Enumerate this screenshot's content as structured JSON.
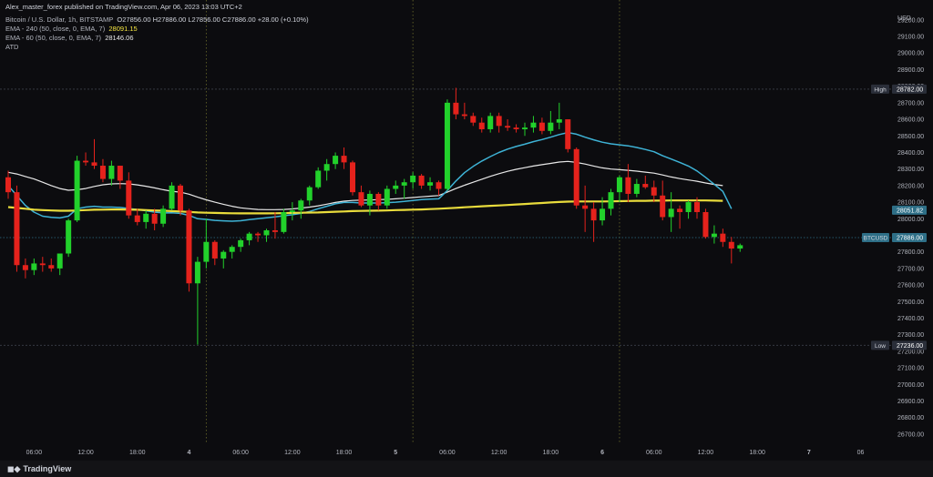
{
  "header": {
    "publisher": "Alex_master_forex published on TradingView.com, Apr 06, 2023 13:03 UTC+2",
    "symbol": "Bitcoin / U.S. Dollar, 1h, BITSTAMP",
    "ohlc": "O27856.00  H27886.00  L27856.00  C27886.00  +28.00 (+0.10%)",
    "ema240_label": "EMA - 240 (50, close, 0, EMA, 7)",
    "ema240_value": "28091.15",
    "ema60_label": "EMA - 60 (50, close, 0, EMA, 7)",
    "ema60_value": "28146.06",
    "atd_label": "ATD"
  },
  "footer": {
    "brand": "TradingView",
    "logo_icon": "tradingview-logo-icon"
  },
  "colors": {
    "background": "#0c0c0f",
    "up": "#22d12b",
    "down": "#e5221c",
    "ema240": "#e9dc3c",
    "ema60": "#e8e8e8",
    "ema_fast": "#3eb3d6",
    "axis_text": "#b2b5be",
    "grid": "#2a2e39"
  },
  "chart_data": {
    "type": "candlestick",
    "currency": "USD",
    "ylim": [
      26650,
      29320
    ],
    "y_ticks": [
      26700,
      26800,
      26900,
      27000,
      27100,
      27200,
      27300,
      27400,
      27500,
      27600,
      27700,
      27800,
      27900,
      28000,
      28100,
      28200,
      28300,
      28400,
      28500,
      28600,
      28700,
      28800,
      28900,
      29000,
      29100,
      29200
    ],
    "x_ticks": [
      {
        "i": 3,
        "label": "06:00"
      },
      {
        "i": 9,
        "label": "12:00"
      },
      {
        "i": 15,
        "label": "18:00"
      },
      {
        "i": 21,
        "label": "4",
        "day": true
      },
      {
        "i": 27,
        "label": "06:00"
      },
      {
        "i": 33,
        "label": "12:00"
      },
      {
        "i": 39,
        "label": "18:00"
      },
      {
        "i": 45,
        "label": "5",
        "day": true
      },
      {
        "i": 51,
        "label": "06:00"
      },
      {
        "i": 57,
        "label": "12:00"
      },
      {
        "i": 63,
        "label": "18:00"
      },
      {
        "i": 69,
        "label": "6",
        "day": true
      },
      {
        "i": 75,
        "label": "06:00"
      },
      {
        "i": 81,
        "label": "12:00"
      },
      {
        "i": 87,
        "label": "18:00"
      },
      {
        "i": 93,
        "label": "7",
        "day": true
      },
      {
        "i": 99,
        "label": "06"
      }
    ],
    "day_separators": [
      23,
      47,
      71
    ],
    "price_labels": [
      {
        "name": "High",
        "value": 28782.0,
        "text": "28782.00",
        "color": "#2a2e39"
      },
      {
        "name": "EMA",
        "value": 28051.82,
        "text": "28051.82",
        "color": "#2e6f87"
      },
      {
        "name": "BTCUSD",
        "value": 27886.0,
        "text": "27886.00",
        "color": "#2e6f87"
      },
      {
        "name": "Low",
        "value": 27236.0,
        "text": "27236.00",
        "color": "#2a2e39"
      }
    ],
    "candles": [
      [
        28250,
        28290,
        28120,
        28160
      ],
      [
        28160,
        28200,
        27680,
        27720
      ],
      [
        27720,
        27760,
        27640,
        27690
      ],
      [
        27690,
        27760,
        27660,
        27730
      ],
      [
        27730,
        27770,
        27680,
        27720
      ],
      [
        27720,
        27760,
        27680,
        27700
      ],
      [
        27700,
        27790,
        27660,
        27790
      ],
      [
        27790,
        28000,
        27770,
        27990
      ],
      [
        27990,
        28380,
        27980,
        28350
      ],
      [
        28350,
        28400,
        28320,
        28340
      ],
      [
        28340,
        28480,
        28300,
        28320
      ],
      [
        28320,
        28360,
        28220,
        28240
      ],
      [
        28240,
        28350,
        28200,
        28320
      ],
      [
        28320,
        28320,
        28180,
        28230
      ],
      [
        28230,
        28280,
        28000,
        28020
      ],
      [
        28020,
        28060,
        27960,
        27980
      ],
      [
        27980,
        28050,
        27940,
        28030
      ],
      [
        28030,
        28060,
        27930,
        27970
      ],
      [
        27970,
        28080,
        27950,
        28060
      ],
      [
        28060,
        28220,
        28050,
        28200
      ],
      [
        28200,
        28210,
        28020,
        28050
      ],
      [
        28050,
        28060,
        27560,
        27610
      ],
      [
        27610,
        27770,
        27240,
        27740
      ],
      [
        27740,
        28000,
        27700,
        27860
      ],
      [
        27860,
        27870,
        27720,
        27760
      ],
      [
        27760,
        27810,
        27700,
        27800
      ],
      [
        27800,
        27840,
        27760,
        27830
      ],
      [
        27830,
        27880,
        27800,
        27870
      ],
      [
        27870,
        27920,
        27840,
        27910
      ],
      [
        27910,
        27920,
        27860,
        27900
      ],
      [
        27900,
        27940,
        27860,
        27930
      ],
      [
        27930,
        28040,
        27880,
        27920
      ],
      [
        27920,
        28060,
        27910,
        28040
      ],
      [
        28040,
        28100,
        27990,
        28050
      ],
      [
        28050,
        28120,
        28000,
        28110
      ],
      [
        28110,
        28200,
        28080,
        28190
      ],
      [
        28190,
        28310,
        28180,
        28290
      ],
      [
        28290,
        28360,
        28230,
        28330
      ],
      [
        28330,
        28400,
        28300,
        28380
      ],
      [
        28380,
        28430,
        28300,
        28340
      ],
      [
        28340,
        28350,
        28140,
        28160
      ],
      [
        28160,
        28200,
        28070,
        28080
      ],
      [
        28080,
        28170,
        28020,
        28150
      ],
      [
        28150,
        28160,
        28050,
        28080
      ],
      [
        28080,
        28200,
        28060,
        28180
      ],
      [
        28180,
        28230,
        28150,
        28200
      ],
      [
        28200,
        28240,
        28120,
        28220
      ],
      [
        28220,
        28280,
        28180,
        28260
      ],
      [
        28260,
        28270,
        28180,
        28200
      ],
      [
        28200,
        28250,
        28170,
        28220
      ],
      [
        28220,
        28230,
        28140,
        28180
      ],
      [
        28180,
        28720,
        28170,
        28700
      ],
      [
        28700,
        28790,
        28600,
        28630
      ],
      [
        28630,
        28700,
        28600,
        28620
      ],
      [
        28620,
        28640,
        28560,
        28580
      ],
      [
        28580,
        28610,
        28520,
        28540
      ],
      [
        28540,
        28640,
        28520,
        28620
      ],
      [
        28620,
        28640,
        28520,
        28560
      ],
      [
        28560,
        28600,
        28530,
        28550
      ],
      [
        28550,
        28570,
        28520,
        28540
      ],
      [
        28540,
        28580,
        28500,
        28550
      ],
      [
        28550,
        28620,
        28520,
        28580
      ],
      [
        28580,
        28610,
        28510,
        28530
      ],
      [
        28530,
        28650,
        28510,
        28580
      ],
      [
        28580,
        28700,
        28540,
        28600
      ],
      [
        28600,
        28600,
        28400,
        28420
      ],
      [
        28420,
        28430,
        28060,
        28080
      ],
      [
        28080,
        28200,
        27920,
        28060
      ],
      [
        28060,
        28100,
        27860,
        27990
      ],
      [
        27990,
        28130,
        27960,
        28060
      ],
      [
        28060,
        28180,
        28020,
        28160
      ],
      [
        28160,
        28260,
        28100,
        28250
      ],
      [
        28250,
        28330,
        28100,
        28150
      ],
      [
        28150,
        28240,
        28130,
        28210
      ],
      [
        28210,
        28260,
        28180,
        28190
      ],
      [
        28190,
        28230,
        28100,
        28140
      ],
      [
        28140,
        28230,
        27990,
        28010
      ],
      [
        28010,
        28160,
        27920,
        28060
      ],
      [
        28060,
        28080,
        27940,
        28040
      ],
      [
        28040,
        28110,
        28000,
        28100
      ],
      [
        28100,
        28130,
        28000,
        28040
      ],
      [
        28040,
        28060,
        27880,
        27890
      ],
      [
        27890,
        27960,
        27850,
        27910
      ],
      [
        27910,
        27940,
        27830,
        27860
      ],
      [
        27860,
        27890,
        27730,
        27820
      ],
      [
        27820,
        27850,
        27800,
        27840
      ]
    ],
    "ema240": [
      28070,
      28065,
      28060,
      28055,
      28052,
      28050,
      28048,
      28048,
      28050,
      28052,
      28054,
      28055,
      28056,
      28056,
      28055,
      28054,
      28052,
      28050,
      28048,
      28046,
      28044,
      28041,
      28038,
      28036,
      28035,
      28034,
      28033,
      28032,
      28032,
      28032,
      28032,
      28033,
      28034,
      28035,
      28036,
      28037,
      28038,
      28040,
      28042,
      28044,
      28046,
      28047,
      28048,
      28049,
      28050,
      28052,
      28053,
      28055,
      28056,
      28058,
      28060,
      28063,
      28066,
      28069,
      28072,
      28075,
      28078,
      28080,
      28083,
      28086,
      28089,
      28092,
      28095,
      28098,
      28101,
      28103,
      28104,
      28104,
      28104,
      28104,
      28105,
      28106,
      28107,
      28108,
      28108,
      28109,
      28109,
      28110,
      28110,
      28110,
      28110,
      28110,
      28109,
      28108
    ],
    "ema60": [
      28280,
      28270,
      28255,
      28240,
      28220,
      28200,
      28182,
      28172,
      28175,
      28182,
      28195,
      28205,
      28210,
      28212,
      28210,
      28204,
      28196,
      28186,
      28175,
      28166,
      28160,
      28148,
      28130,
      28114,
      28100,
      28087,
      28075,
      28066,
      28060,
      28056,
      28055,
      28055,
      28056,
      28059,
      28064,
      28070,
      28078,
      28088,
      28098,
      28106,
      28110,
      28112,
      28113,
      28115,
      28117,
      28120,
      28124,
      28128,
      28132,
      28136,
      28140,
      28160,
      28182,
      28202,
      28220,
      28238,
      28256,
      28272,
      28286,
      28298,
      28308,
      28318,
      28326,
      28334,
      28342,
      28346,
      28340,
      28330,
      28318,
      28307,
      28300,
      28296,
      28292,
      28287,
      28281,
      28275,
      28264,
      28252,
      28242,
      28234,
      28226,
      28216,
      28207,
      28200
    ],
    "ema_fast": [
      28200,
      28140,
      28080,
      28040,
      28015,
      28008,
      28005,
      28015,
      28060,
      28070,
      28075,
      28070,
      28070,
      28068,
      28062,
      28055,
      28048,
      28040,
      28035,
      28036,
      28032,
      28020,
      28000,
      27996,
      27990,
      27987,
      27985,
      27988,
      27995,
      28000,
      28006,
      28011,
      28018,
      28024,
      28032,
      28044,
      28060,
      28075,
      28090,
      28098,
      28098,
      28095,
      28095,
      28095,
      28097,
      28100,
      28104,
      28110,
      28115,
      28118,
      28120,
      28170,
      28228,
      28278,
      28316,
      28348,
      28375,
      28400,
      28420,
      28436,
      28450,
      28465,
      28478,
      28492,
      28508,
      28520,
      28510,
      28492,
      28476,
      28462,
      28452,
      28446,
      28440,
      28430,
      28418,
      28404,
      28380,
      28360,
      28340,
      28318,
      28288,
      28250,
      28208,
      28165,
      28060
    ]
  }
}
